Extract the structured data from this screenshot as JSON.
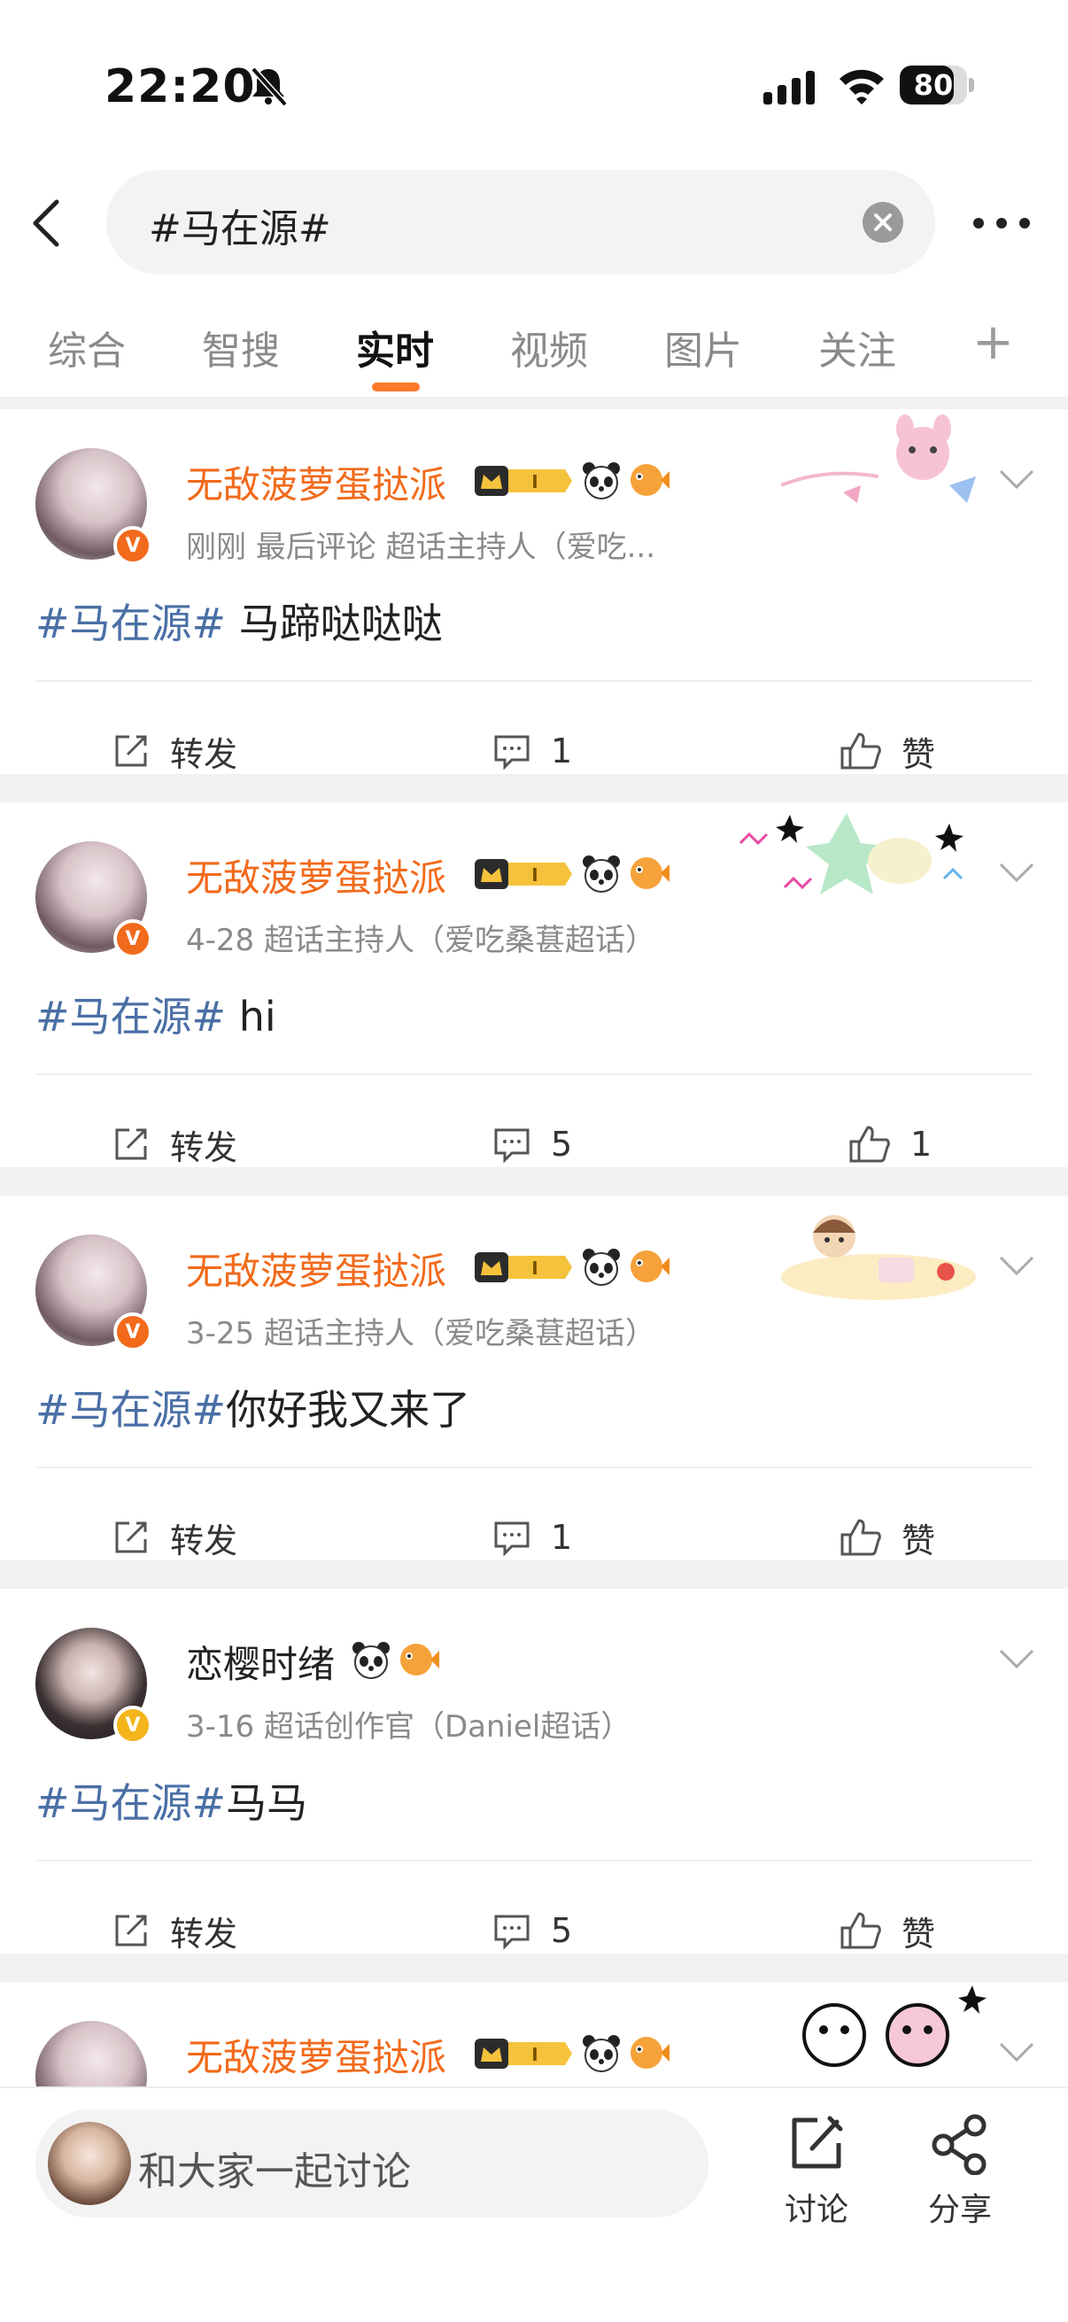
{
  "status_bar": {
    "time": "22:20",
    "battery": "80",
    "battery_level": 0.8
  },
  "search": {
    "query": "#马在源#"
  },
  "tabs": [
    {
      "label": "综合"
    },
    {
      "label": "智搜"
    },
    {
      "label": "实时"
    },
    {
      "label": "视频"
    },
    {
      "label": "图片"
    },
    {
      "label": "关注"
    }
  ],
  "tab_plus": "+",
  "posts": [
    {
      "username": "无敌菠萝蛋挞派",
      "meta": "刚刚  最后评论  超话主持人（爱吃...",
      "hashtag": "#马在源#",
      "text": " 马蹄哒哒哒",
      "repost": "转发",
      "comments": "1",
      "likes": "赞"
    },
    {
      "username": "无敌菠萝蛋挞派",
      "meta": "4-28  超话主持人（爱吃桑葚超话）",
      "hashtag": "#马在源#",
      "text": " hi",
      "repost": "转发",
      "comments": "5",
      "likes": "1"
    },
    {
      "username": "无敌菠萝蛋挞派",
      "meta": "3-25  超话主持人（爱吃桑葚超话）",
      "hashtag": "#马在源#",
      "text": "你好我又来了",
      "repost": "转发",
      "comments": "1",
      "likes": "赞"
    },
    {
      "username": "恋樱时绪",
      "meta": "3-16  超话创作官（Daniel超话）",
      "hashtag": "#马在源#",
      "text": "马马",
      "repost": "转发",
      "comments": "5",
      "likes": "赞"
    },
    {
      "username": "无敌菠萝蛋挞派"
    }
  ],
  "bottom_bar": {
    "placeholder": "和大家一起讨论",
    "discuss": "讨论",
    "share": "分享"
  },
  "colors": {
    "accent": "#ff7a2a",
    "username": "#f26a1b",
    "hashtag": "#4a6fa5"
  }
}
